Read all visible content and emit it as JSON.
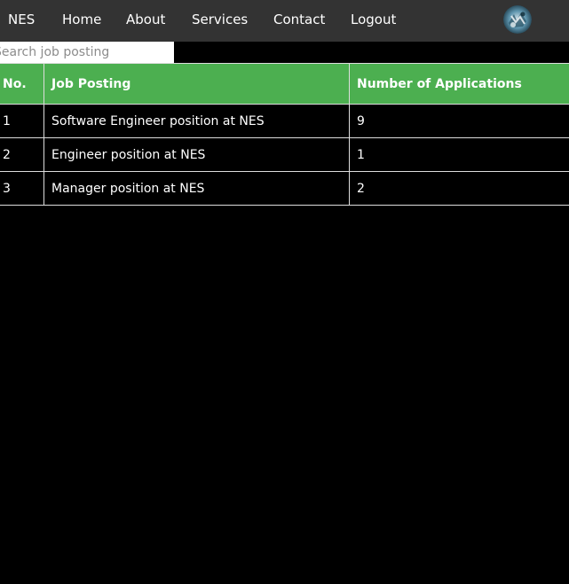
{
  "nav": {
    "brand": "NES",
    "links": [
      "Home",
      "About",
      "Services",
      "Contact",
      "Logout"
    ]
  },
  "avatar": {
    "icon": "user-avatar-icon"
  },
  "search": {
    "placeholder": "Search job posting",
    "value": ""
  },
  "table": {
    "headers": [
      "No.",
      "Job Posting",
      "Number of Applications"
    ],
    "rows": [
      [
        "1",
        "Software Engineer position at NES",
        "9"
      ],
      [
        "2",
        "Engineer position at NES",
        "1"
      ],
      [
        "3",
        "Manager position at NES",
        "2"
      ]
    ]
  },
  "colors": {
    "navbar": "#333333",
    "header": "#4caf50",
    "background": "#000000"
  }
}
